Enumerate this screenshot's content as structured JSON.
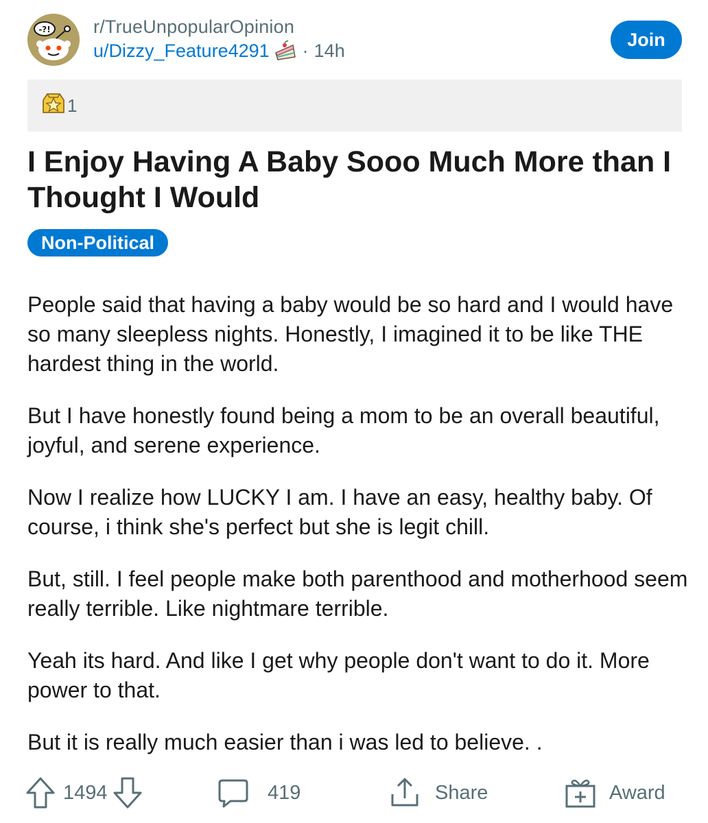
{
  "header": {
    "subreddit": "r/TrueUnpopularOpinion",
    "author": "u/Dizzy_Feature4291",
    "separator": "·",
    "time_ago": "14h",
    "join_label": "Join"
  },
  "awards": {
    "count": "1"
  },
  "post": {
    "title": "I Enjoy Having A Baby Sooo Much More than I Thought I Would",
    "flair": "Non-Political",
    "paragraphs": [
      "People said that having a baby would be so hard and I would have so many sleepless nights. Honestly, I imagined it to be like THE hardest thing in the world.",
      "But I have honestly found being a mom to be an overall beautiful, joyful, and serene experience.",
      "Now I realize how LUCKY I am. I have an easy, healthy baby. Of course,  i think she's perfect but she is legit chill.",
      "But, still. I feel people make both parenthood and motherhood seem really terrible. Like nightmare terrible.",
      "Yeah its hard. And like I get why people don't want to do it. More power to that.",
      "But it is really much easier than i was led to believe. ."
    ]
  },
  "actions": {
    "upvotes": "1494",
    "comments": "419",
    "share_label": "Share",
    "award_label": "Award"
  },
  "colors": {
    "accent": "#0079d3",
    "muted_text": "#576f76",
    "awards_bar_bg": "#f0f0f0",
    "avatar_bg": "#b3a064"
  },
  "icons": [
    "subreddit-avatar-icon",
    "cake-day-icon",
    "award-badge-icon",
    "upvote-icon",
    "downvote-icon",
    "comment-icon",
    "share-icon",
    "award-gift-icon"
  ]
}
